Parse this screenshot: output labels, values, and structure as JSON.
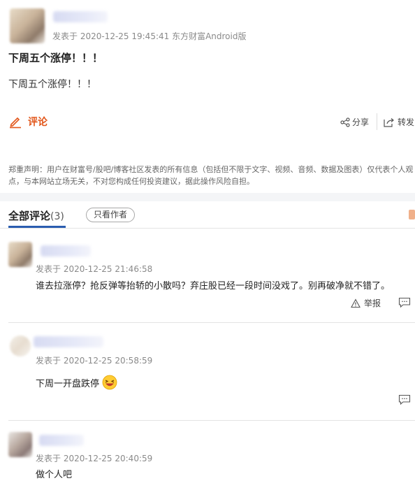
{
  "post": {
    "meta": "发表于 2020-12-25 19:45:41 东方财富Android版",
    "title": "下周五个涨停！！！",
    "body": "下周五个涨停！！！"
  },
  "actions": {
    "comment": "评论",
    "share": "分享",
    "forward": "转发"
  },
  "disclaimer": "郑重声明：用户在财富号/股吧/博客社区发表的所有信息（包括但不限于文字、视频、音频、数据及图表）仅代表个人观点，与本网站立场无关，不对您构成任何投资建议，据此操作风险自担。",
  "comments_header": {
    "tab_label": "全部评论",
    "count": "(3)",
    "author_only": "只看作者"
  },
  "comments": [
    {
      "meta": "发表于 2020-12-25 21:46:58",
      "text": "谁去拉涨停？抢反弹等抬轿的小散吗？弃庄股已经一段时间没戏了。别再破净就不错了。",
      "report": "举报"
    },
    {
      "meta": "发表于 2020-12-25 20:58:59",
      "text": "下周一开盘跌停"
    },
    {
      "meta": "发表于 2020-12-25 20:40:59",
      "text": "做个人吧"
    }
  ],
  "colors": {
    "accent": "#e2561a",
    "tab_underline": "#2a5db0"
  }
}
